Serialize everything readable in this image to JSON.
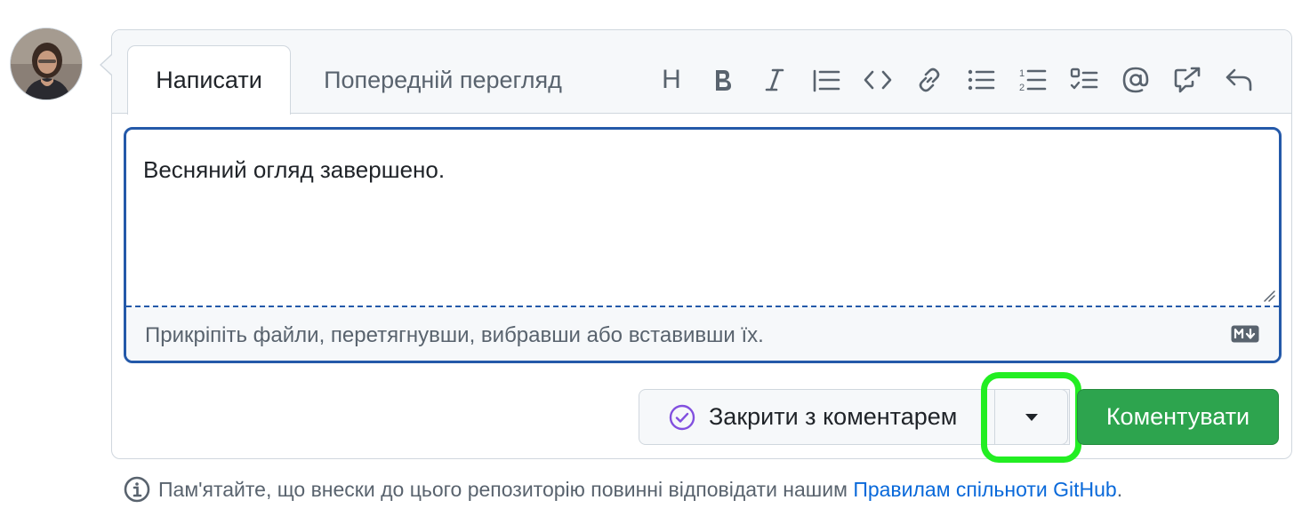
{
  "avatar": {
    "icon": "user-avatar-photo"
  },
  "tabs": {
    "write_label": "Написати",
    "preview_label": "Попередній перегляд"
  },
  "toolbar": {
    "heading_label": "H",
    "icons": [
      "heading-icon",
      "bold-icon",
      "italic-icon",
      "quote-icon",
      "code-icon",
      "link-icon",
      "unordered-list-icon",
      "ordered-list-icon",
      "task-list-icon",
      "mention-icon",
      "reference-icon",
      "reply-icon"
    ],
    "ordered_digits": [
      "1",
      "2"
    ]
  },
  "editor": {
    "value": "Весняний огляд завершено.",
    "attach_hint": "Прикріпіть файли, перетягнувши, вибравши або вставивши їх.",
    "markdown_badge_icon": "markdown-icon"
  },
  "actions": {
    "close_label": "Закрити з коментарем",
    "comment_label": "Коментувати",
    "highlight_color": "#22ee22",
    "primary_color": "#2da44e",
    "focus_color": "#2459a9"
  },
  "notice": {
    "text": "Пам'ятайте, що внески до цього репозиторію повинні відповідати нашим ",
    "link": "Правилам спільноти GitHub",
    "suffix": "."
  }
}
